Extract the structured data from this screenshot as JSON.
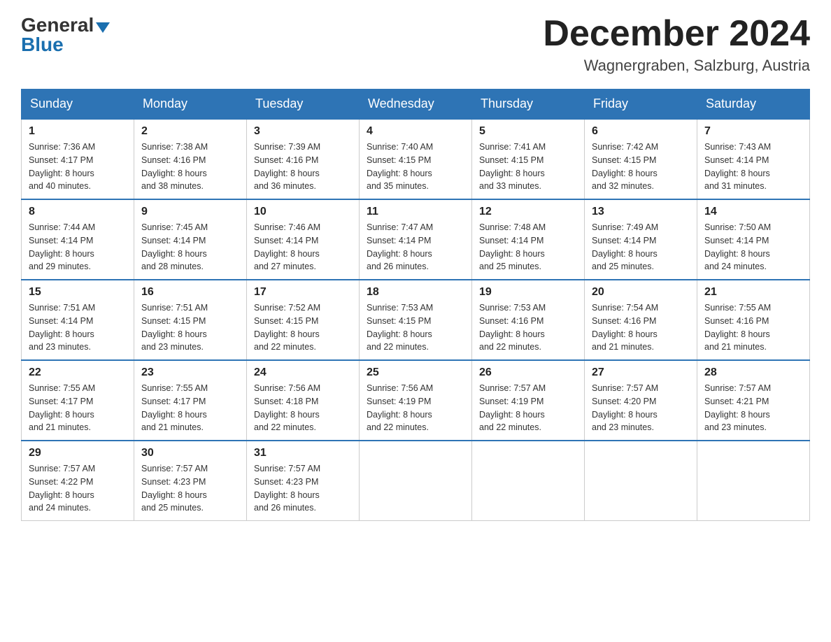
{
  "header": {
    "logo_general": "General",
    "logo_blue": "Blue",
    "month_title": "December 2024",
    "location": "Wagnergraben, Salzburg, Austria"
  },
  "weekdays": [
    "Sunday",
    "Monday",
    "Tuesday",
    "Wednesday",
    "Thursday",
    "Friday",
    "Saturday"
  ],
  "weeks": [
    [
      {
        "day": "1",
        "sunrise": "7:36 AM",
        "sunset": "4:17 PM",
        "daylight": "8 hours and 40 minutes."
      },
      {
        "day": "2",
        "sunrise": "7:38 AM",
        "sunset": "4:16 PM",
        "daylight": "8 hours and 38 minutes."
      },
      {
        "day": "3",
        "sunrise": "7:39 AM",
        "sunset": "4:16 PM",
        "daylight": "8 hours and 36 minutes."
      },
      {
        "day": "4",
        "sunrise": "7:40 AM",
        "sunset": "4:15 PM",
        "daylight": "8 hours and 35 minutes."
      },
      {
        "day": "5",
        "sunrise": "7:41 AM",
        "sunset": "4:15 PM",
        "daylight": "8 hours and 33 minutes."
      },
      {
        "day": "6",
        "sunrise": "7:42 AM",
        "sunset": "4:15 PM",
        "daylight": "8 hours and 32 minutes."
      },
      {
        "day": "7",
        "sunrise": "7:43 AM",
        "sunset": "4:14 PM",
        "daylight": "8 hours and 31 minutes."
      }
    ],
    [
      {
        "day": "8",
        "sunrise": "7:44 AM",
        "sunset": "4:14 PM",
        "daylight": "8 hours and 29 minutes."
      },
      {
        "day": "9",
        "sunrise": "7:45 AM",
        "sunset": "4:14 PM",
        "daylight": "8 hours and 28 minutes."
      },
      {
        "day": "10",
        "sunrise": "7:46 AM",
        "sunset": "4:14 PM",
        "daylight": "8 hours and 27 minutes."
      },
      {
        "day": "11",
        "sunrise": "7:47 AM",
        "sunset": "4:14 PM",
        "daylight": "8 hours and 26 minutes."
      },
      {
        "day": "12",
        "sunrise": "7:48 AM",
        "sunset": "4:14 PM",
        "daylight": "8 hours and 25 minutes."
      },
      {
        "day": "13",
        "sunrise": "7:49 AM",
        "sunset": "4:14 PM",
        "daylight": "8 hours and 25 minutes."
      },
      {
        "day": "14",
        "sunrise": "7:50 AM",
        "sunset": "4:14 PM",
        "daylight": "8 hours and 24 minutes."
      }
    ],
    [
      {
        "day": "15",
        "sunrise": "7:51 AM",
        "sunset": "4:14 PM",
        "daylight": "8 hours and 23 minutes."
      },
      {
        "day": "16",
        "sunrise": "7:51 AM",
        "sunset": "4:15 PM",
        "daylight": "8 hours and 23 minutes."
      },
      {
        "day": "17",
        "sunrise": "7:52 AM",
        "sunset": "4:15 PM",
        "daylight": "8 hours and 22 minutes."
      },
      {
        "day": "18",
        "sunrise": "7:53 AM",
        "sunset": "4:15 PM",
        "daylight": "8 hours and 22 minutes."
      },
      {
        "day": "19",
        "sunrise": "7:53 AM",
        "sunset": "4:16 PM",
        "daylight": "8 hours and 22 minutes."
      },
      {
        "day": "20",
        "sunrise": "7:54 AM",
        "sunset": "4:16 PM",
        "daylight": "8 hours and 21 minutes."
      },
      {
        "day": "21",
        "sunrise": "7:55 AM",
        "sunset": "4:16 PM",
        "daylight": "8 hours and 21 minutes."
      }
    ],
    [
      {
        "day": "22",
        "sunrise": "7:55 AM",
        "sunset": "4:17 PM",
        "daylight": "8 hours and 21 minutes."
      },
      {
        "day": "23",
        "sunrise": "7:55 AM",
        "sunset": "4:17 PM",
        "daylight": "8 hours and 21 minutes."
      },
      {
        "day": "24",
        "sunrise": "7:56 AM",
        "sunset": "4:18 PM",
        "daylight": "8 hours and 22 minutes."
      },
      {
        "day": "25",
        "sunrise": "7:56 AM",
        "sunset": "4:19 PM",
        "daylight": "8 hours and 22 minutes."
      },
      {
        "day": "26",
        "sunrise": "7:57 AM",
        "sunset": "4:19 PM",
        "daylight": "8 hours and 22 minutes."
      },
      {
        "day": "27",
        "sunrise": "7:57 AM",
        "sunset": "4:20 PM",
        "daylight": "8 hours and 23 minutes."
      },
      {
        "day": "28",
        "sunrise": "7:57 AM",
        "sunset": "4:21 PM",
        "daylight": "8 hours and 23 minutes."
      }
    ],
    [
      {
        "day": "29",
        "sunrise": "7:57 AM",
        "sunset": "4:22 PM",
        "daylight": "8 hours and 24 minutes."
      },
      {
        "day": "30",
        "sunrise": "7:57 AM",
        "sunset": "4:23 PM",
        "daylight": "8 hours and 25 minutes."
      },
      {
        "day": "31",
        "sunrise": "7:57 AM",
        "sunset": "4:23 PM",
        "daylight": "8 hours and 26 minutes."
      },
      null,
      null,
      null,
      null
    ]
  ],
  "labels": {
    "sunrise": "Sunrise: ",
    "sunset": "Sunset: ",
    "daylight": "Daylight: "
  }
}
